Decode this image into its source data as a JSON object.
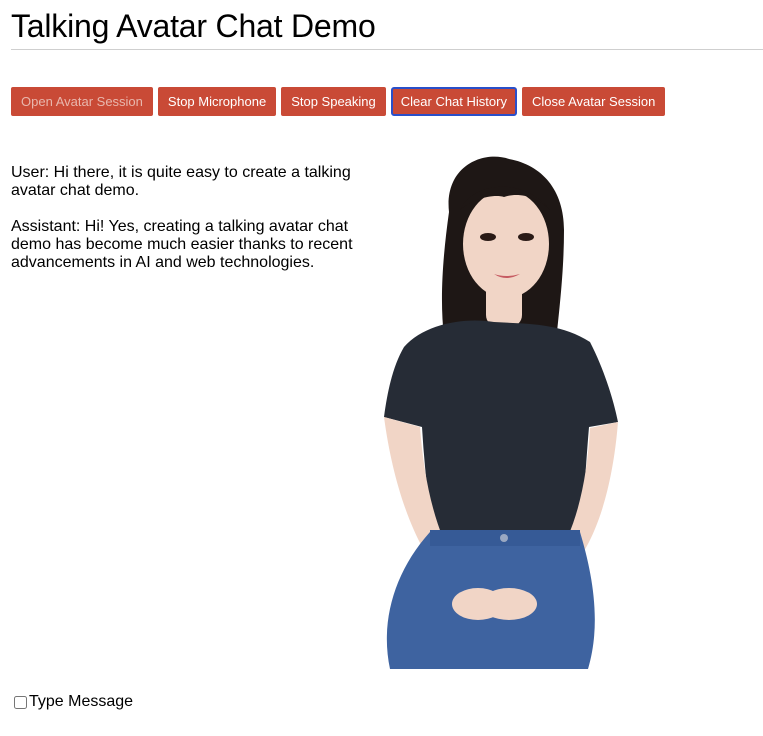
{
  "page": {
    "title": "Talking Avatar Chat Demo"
  },
  "toolbar": {
    "buttons": [
      {
        "label": "Open Avatar Session",
        "state": "disabled"
      },
      {
        "label": "Stop Microphone",
        "state": "enabled"
      },
      {
        "label": "Stop Speaking",
        "state": "enabled"
      },
      {
        "label": "Clear Chat History",
        "state": "focused"
      },
      {
        "label": "Close Avatar Session",
        "state": "enabled"
      }
    ],
    "button_color": "#c94a36",
    "focus_color": "#2a4fc9"
  },
  "chat": {
    "messages": [
      {
        "text": "User: Hi there, it is quite easy to create a talking avatar chat demo."
      },
      {
        "text": "Assistant: Hi! Yes, creating a talking avatar chat demo has become much easier thanks to recent advancements in AI and web technologies."
      }
    ]
  },
  "avatar": {
    "colors": {
      "shirt": "#262c36",
      "jeans": "#3e63a0",
      "hair": "#1e1715",
      "skin": "#f1d5c6"
    }
  },
  "controls": {
    "type_message_label": "Type Message",
    "type_message_checked": false
  }
}
